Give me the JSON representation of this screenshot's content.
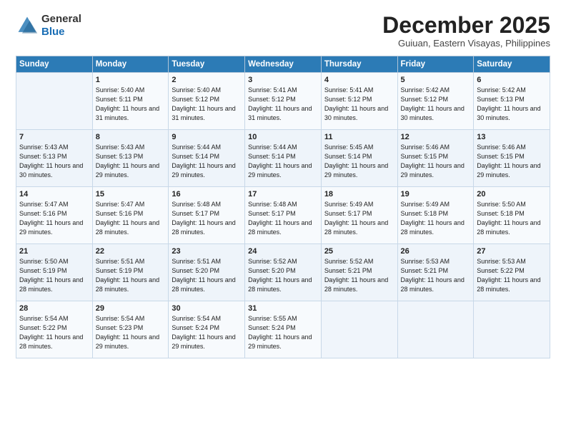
{
  "logo": {
    "general": "General",
    "blue": "Blue"
  },
  "title": "December 2025",
  "location": "Guiuan, Eastern Visayas, Philippines",
  "days_header": [
    "Sunday",
    "Monday",
    "Tuesday",
    "Wednesday",
    "Thursday",
    "Friday",
    "Saturday"
  ],
  "weeks": [
    [
      {
        "day": "",
        "sunrise": "",
        "sunset": "",
        "daylight": ""
      },
      {
        "day": "1",
        "sunrise": "Sunrise: 5:40 AM",
        "sunset": "Sunset: 5:11 PM",
        "daylight": "Daylight: 11 hours and 31 minutes."
      },
      {
        "day": "2",
        "sunrise": "Sunrise: 5:40 AM",
        "sunset": "Sunset: 5:12 PM",
        "daylight": "Daylight: 11 hours and 31 minutes."
      },
      {
        "day": "3",
        "sunrise": "Sunrise: 5:41 AM",
        "sunset": "Sunset: 5:12 PM",
        "daylight": "Daylight: 11 hours and 31 minutes."
      },
      {
        "day": "4",
        "sunrise": "Sunrise: 5:41 AM",
        "sunset": "Sunset: 5:12 PM",
        "daylight": "Daylight: 11 hours and 30 minutes."
      },
      {
        "day": "5",
        "sunrise": "Sunrise: 5:42 AM",
        "sunset": "Sunset: 5:12 PM",
        "daylight": "Daylight: 11 hours and 30 minutes."
      },
      {
        "day": "6",
        "sunrise": "Sunrise: 5:42 AM",
        "sunset": "Sunset: 5:13 PM",
        "daylight": "Daylight: 11 hours and 30 minutes."
      }
    ],
    [
      {
        "day": "7",
        "sunrise": "Sunrise: 5:43 AM",
        "sunset": "Sunset: 5:13 PM",
        "daylight": "Daylight: 11 hours and 30 minutes."
      },
      {
        "day": "8",
        "sunrise": "Sunrise: 5:43 AM",
        "sunset": "Sunset: 5:13 PM",
        "daylight": "Daylight: 11 hours and 29 minutes."
      },
      {
        "day": "9",
        "sunrise": "Sunrise: 5:44 AM",
        "sunset": "Sunset: 5:14 PM",
        "daylight": "Daylight: 11 hours and 29 minutes."
      },
      {
        "day": "10",
        "sunrise": "Sunrise: 5:44 AM",
        "sunset": "Sunset: 5:14 PM",
        "daylight": "Daylight: 11 hours and 29 minutes."
      },
      {
        "day": "11",
        "sunrise": "Sunrise: 5:45 AM",
        "sunset": "Sunset: 5:14 PM",
        "daylight": "Daylight: 11 hours and 29 minutes."
      },
      {
        "day": "12",
        "sunrise": "Sunrise: 5:46 AM",
        "sunset": "Sunset: 5:15 PM",
        "daylight": "Daylight: 11 hours and 29 minutes."
      },
      {
        "day": "13",
        "sunrise": "Sunrise: 5:46 AM",
        "sunset": "Sunset: 5:15 PM",
        "daylight": "Daylight: 11 hours and 29 minutes."
      }
    ],
    [
      {
        "day": "14",
        "sunrise": "Sunrise: 5:47 AM",
        "sunset": "Sunset: 5:16 PM",
        "daylight": "Daylight: 11 hours and 29 minutes."
      },
      {
        "day": "15",
        "sunrise": "Sunrise: 5:47 AM",
        "sunset": "Sunset: 5:16 PM",
        "daylight": "Daylight: 11 hours and 28 minutes."
      },
      {
        "day": "16",
        "sunrise": "Sunrise: 5:48 AM",
        "sunset": "Sunset: 5:17 PM",
        "daylight": "Daylight: 11 hours and 28 minutes."
      },
      {
        "day": "17",
        "sunrise": "Sunrise: 5:48 AM",
        "sunset": "Sunset: 5:17 PM",
        "daylight": "Daylight: 11 hours and 28 minutes."
      },
      {
        "day": "18",
        "sunrise": "Sunrise: 5:49 AM",
        "sunset": "Sunset: 5:17 PM",
        "daylight": "Daylight: 11 hours and 28 minutes."
      },
      {
        "day": "19",
        "sunrise": "Sunrise: 5:49 AM",
        "sunset": "Sunset: 5:18 PM",
        "daylight": "Daylight: 11 hours and 28 minutes."
      },
      {
        "day": "20",
        "sunrise": "Sunrise: 5:50 AM",
        "sunset": "Sunset: 5:18 PM",
        "daylight": "Daylight: 11 hours and 28 minutes."
      }
    ],
    [
      {
        "day": "21",
        "sunrise": "Sunrise: 5:50 AM",
        "sunset": "Sunset: 5:19 PM",
        "daylight": "Daylight: 11 hours and 28 minutes."
      },
      {
        "day": "22",
        "sunrise": "Sunrise: 5:51 AM",
        "sunset": "Sunset: 5:19 PM",
        "daylight": "Daylight: 11 hours and 28 minutes."
      },
      {
        "day": "23",
        "sunrise": "Sunrise: 5:51 AM",
        "sunset": "Sunset: 5:20 PM",
        "daylight": "Daylight: 11 hours and 28 minutes."
      },
      {
        "day": "24",
        "sunrise": "Sunrise: 5:52 AM",
        "sunset": "Sunset: 5:20 PM",
        "daylight": "Daylight: 11 hours and 28 minutes."
      },
      {
        "day": "25",
        "sunrise": "Sunrise: 5:52 AM",
        "sunset": "Sunset: 5:21 PM",
        "daylight": "Daylight: 11 hours and 28 minutes."
      },
      {
        "day": "26",
        "sunrise": "Sunrise: 5:53 AM",
        "sunset": "Sunset: 5:21 PM",
        "daylight": "Daylight: 11 hours and 28 minutes."
      },
      {
        "day": "27",
        "sunrise": "Sunrise: 5:53 AM",
        "sunset": "Sunset: 5:22 PM",
        "daylight": "Daylight: 11 hours and 28 minutes."
      }
    ],
    [
      {
        "day": "28",
        "sunrise": "Sunrise: 5:54 AM",
        "sunset": "Sunset: 5:22 PM",
        "daylight": "Daylight: 11 hours and 28 minutes."
      },
      {
        "day": "29",
        "sunrise": "Sunrise: 5:54 AM",
        "sunset": "Sunset: 5:23 PM",
        "daylight": "Daylight: 11 hours and 29 minutes."
      },
      {
        "day": "30",
        "sunrise": "Sunrise: 5:54 AM",
        "sunset": "Sunset: 5:24 PM",
        "daylight": "Daylight: 11 hours and 29 minutes."
      },
      {
        "day": "31",
        "sunrise": "Sunrise: 5:55 AM",
        "sunset": "Sunset: 5:24 PM",
        "daylight": "Daylight: 11 hours and 29 minutes."
      },
      {
        "day": "",
        "sunrise": "",
        "sunset": "",
        "daylight": ""
      },
      {
        "day": "",
        "sunrise": "",
        "sunset": "",
        "daylight": ""
      },
      {
        "day": "",
        "sunrise": "",
        "sunset": "",
        "daylight": ""
      }
    ]
  ]
}
